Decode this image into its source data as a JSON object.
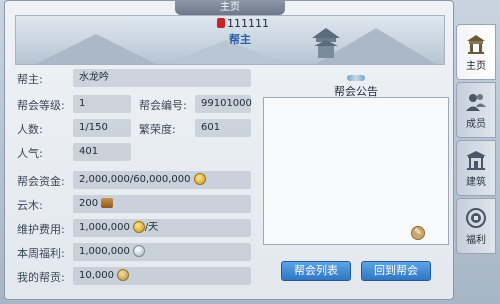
{
  "window": {
    "title": "主页"
  },
  "banner": {
    "leader_name": "111111",
    "leader_role": "帮主"
  },
  "info": {
    "leader_label": "帮主:",
    "leader_value": "水龙吟",
    "level_label": "帮会等级:",
    "level_value": "1",
    "id_label": "帮会编号:",
    "id_value": "99101000",
    "members_label": "人数:",
    "members_value": "1/150",
    "prosperity_label": "繁荣度:",
    "prosperity_value": "601",
    "popularity_label": "人气:",
    "popularity_value": "401",
    "funds_label": "帮会资金:",
    "funds_value": "2,000,000/60,000,000",
    "wood_label": "云木:",
    "wood_value": "200",
    "upkeep_label": "维护费用:",
    "upkeep_value": "1,000,000",
    "upkeep_unit": "/天",
    "weekly_label": "本周福利:",
    "weekly_value": "1,000,000",
    "mine_label": "我的帮贡:",
    "mine_value": "10,000"
  },
  "notice": {
    "title": "帮会公告"
  },
  "buttons": {
    "guild_list": "帮会列表",
    "return_guild": "回到帮会"
  },
  "nav": [
    {
      "label": "主页",
      "icon": "home-icon",
      "active": true
    },
    {
      "label": "成员",
      "icon": "members-icon",
      "active": false
    },
    {
      "label": "建筑",
      "icon": "building-icon",
      "active": false
    },
    {
      "label": "福利",
      "icon": "welfare-icon",
      "active": false
    }
  ]
}
